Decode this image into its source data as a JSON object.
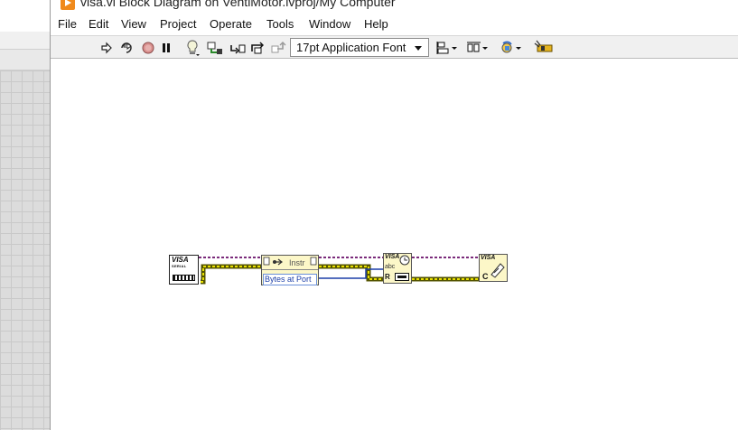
{
  "window": {
    "title": "visa.vi Block Diagram on VentiMotor.lvproj/My Computer"
  },
  "menu": [
    "File",
    "Edit",
    "View",
    "Project",
    "Operate",
    "Tools",
    "Window",
    "Help"
  ],
  "toolbar": {
    "buttons": [
      {
        "name": "run-arrow-icon",
        "glyph": "⇨"
      },
      {
        "name": "run-continuously-icon",
        "glyph": "⟳"
      },
      {
        "name": "abort-icon",
        "glyph": "●"
      },
      {
        "name": "pause-icon",
        "glyph": "❚❚"
      },
      {
        "name": "highlight-execution-icon",
        "glyph": "💡"
      },
      {
        "name": "retain-wire-values-icon",
        "glyph": "⚙"
      },
      {
        "name": "step-into-icon",
        "glyph": "↳"
      },
      {
        "name": "step-over-icon",
        "glyph": "⤼"
      },
      {
        "name": "step-out-icon",
        "glyph": "⤴"
      }
    ],
    "font_select": "17pt Application Font",
    "right_buttons": [
      {
        "name": "align-objects-icon",
        "glyph": "⊟▾"
      },
      {
        "name": "distribute-objects-icon",
        "glyph": "⊞▾"
      },
      {
        "name": "reorder-icon",
        "glyph": "⟲▾"
      },
      {
        "name": "clean-up-diagram-icon",
        "glyph": "✦"
      }
    ]
  },
  "diagram": {
    "visa_constant": {
      "label": "VISA",
      "sublabel": "SERIAL"
    },
    "property_node": {
      "property": "Instr",
      "item": "Bytes at Port"
    },
    "visa_read": {
      "label": "VISA",
      "sub": "abc",
      "mode": "R"
    },
    "visa_close": {
      "label": "VISA",
      "mode": "C"
    },
    "colors": {
      "visa_wire": "#7b2b7b",
      "error_wire_light": "#e8e000",
      "error_wire_dark": "#545400",
      "number_wire": "#1c3fa8",
      "node_fill": "#fcf7c8"
    }
  }
}
